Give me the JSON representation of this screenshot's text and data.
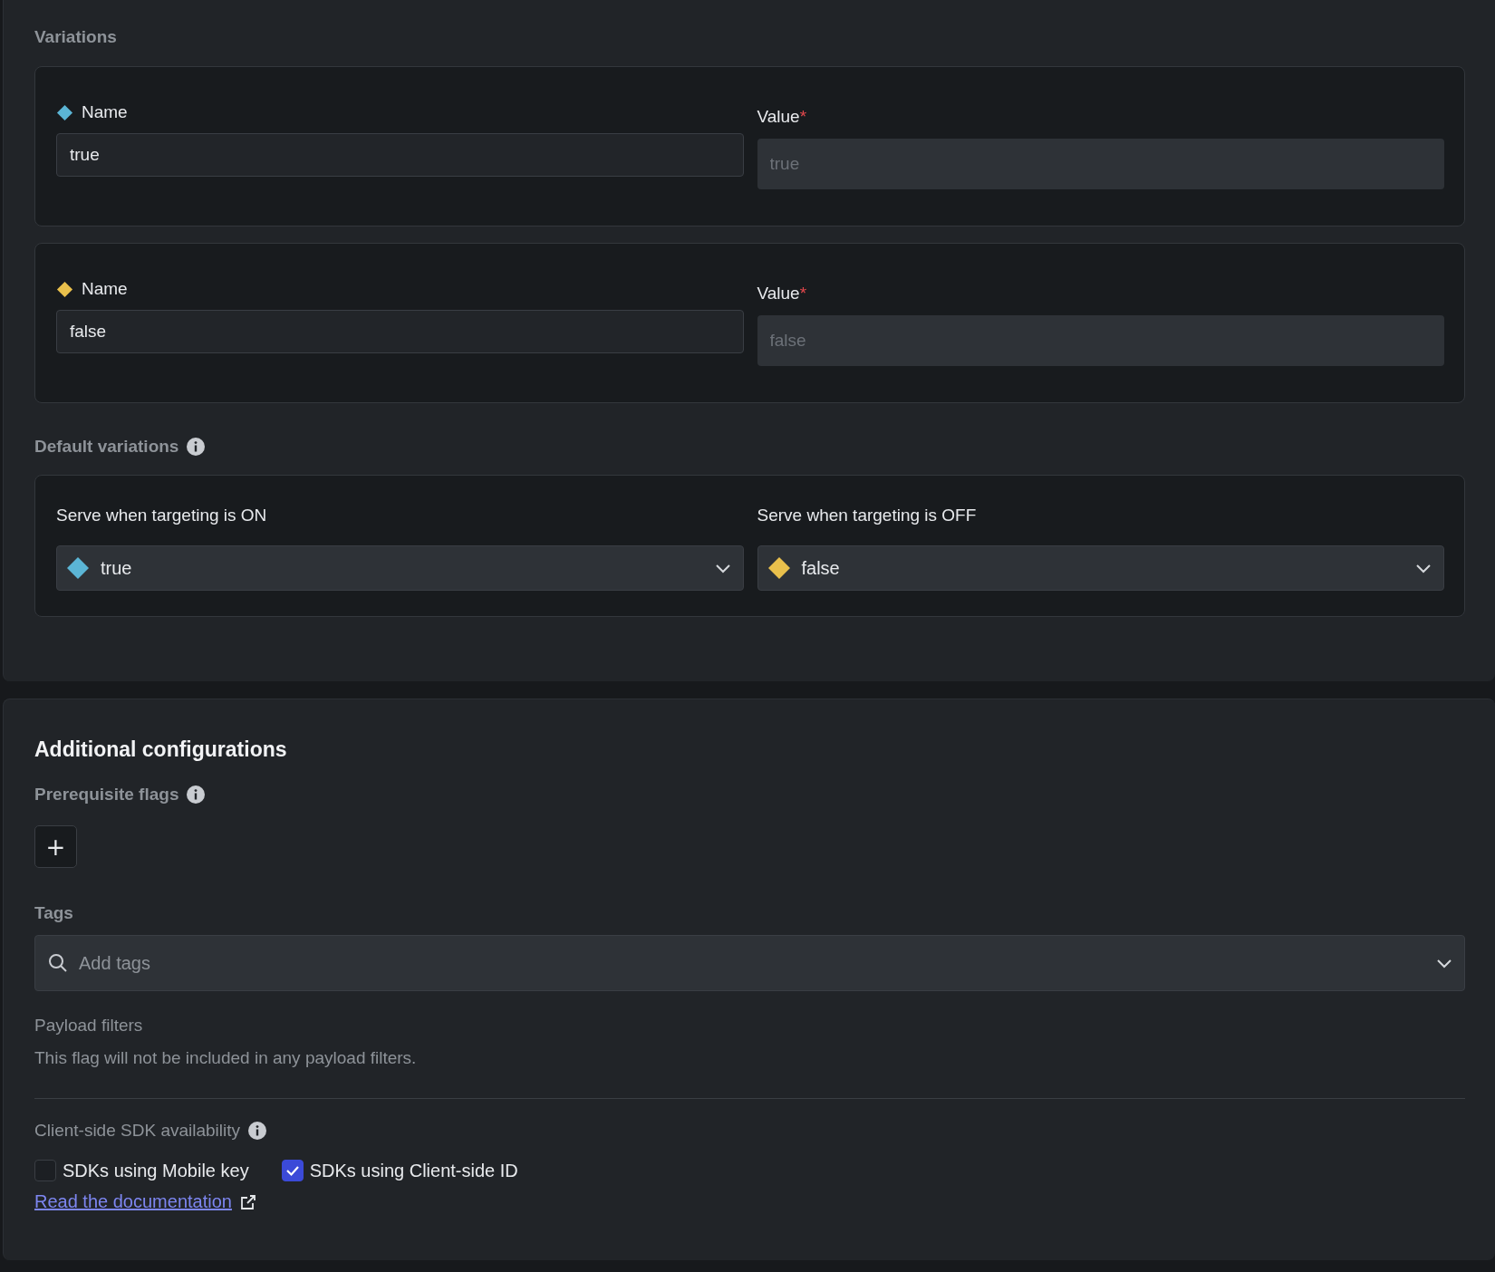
{
  "variations": {
    "label": "Variations",
    "items": [
      {
        "name_label": "Name",
        "name": "true",
        "value_label": "Value",
        "required_mark": "*",
        "value_placeholder": "true",
        "color": "#5bb5d5"
      },
      {
        "name_label": "Name",
        "name": "false",
        "value_label": "Value",
        "required_mark": "*",
        "value_placeholder": "false",
        "color": "#e9c04c"
      }
    ]
  },
  "default_variations": {
    "label": "Default variations",
    "targets": [
      {
        "label": "Serve when targeting is ON",
        "value": "true",
        "color": "#5bb5d5"
      },
      {
        "label": "Serve when targeting is OFF",
        "value": "false",
        "color": "#e9c04c"
      }
    ]
  },
  "additional": {
    "title": "Additional configurations",
    "prerequisites_label": "Prerequisite flags",
    "add_button": "+",
    "tags": {
      "label": "Tags",
      "placeholder": "Add tags"
    },
    "payload_filters": {
      "label": "Payload filters",
      "text": "This flag will not be included in any payload filters."
    },
    "sdk": {
      "label": "Client-side SDK availability",
      "options": [
        {
          "label": "SDKs using Mobile key",
          "checked": false
        },
        {
          "label": "SDKs using Client-side ID",
          "checked": true
        }
      ]
    },
    "link": "Read the documentation"
  }
}
